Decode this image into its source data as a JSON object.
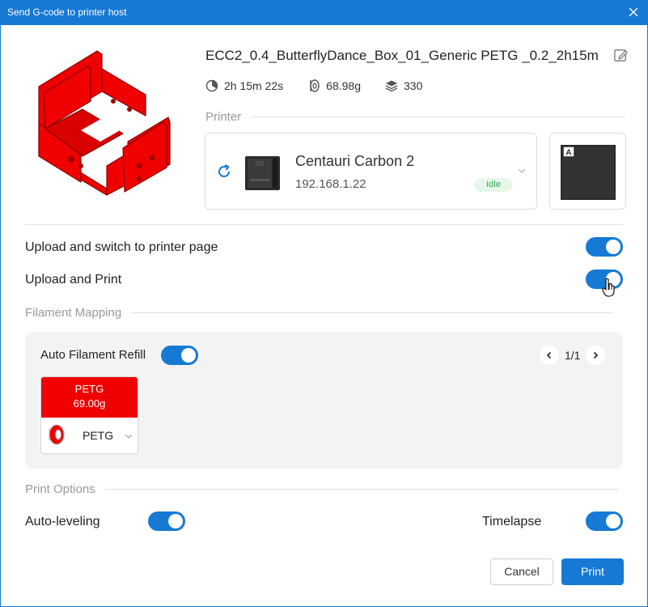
{
  "window": {
    "title": "Send G-code to printer host"
  },
  "file": {
    "name": "ECC2_0.4_ButterflyDance_Box_01_Generic PETG _0.2_2h15m",
    "print_time": "2h 15m 22s",
    "filament_weight": "68.98g",
    "layers": "330"
  },
  "printer": {
    "section_label": "Printer",
    "name": "Centauri Carbon 2",
    "ip": "192.168.1.22",
    "status": "Idle",
    "plate_letter": "A"
  },
  "options": {
    "upload_switch": {
      "label": "Upload and switch to printer page",
      "enabled": true
    },
    "upload_print": {
      "label": "Upload and Print",
      "enabled": true
    }
  },
  "filament_mapping": {
    "section_label": "Filament Mapping",
    "auto_refill": {
      "label": "Auto Filament Refill",
      "enabled": true
    },
    "page": "1/1",
    "slots": [
      {
        "type": "PETG",
        "weight": "69.00g",
        "color": "#f00000",
        "mapped": "PETG"
      }
    ]
  },
  "print_options": {
    "section_label": "Print Options",
    "auto_leveling": {
      "label": "Auto-leveling",
      "enabled": true
    },
    "timelapse": {
      "label": "Timelapse",
      "enabled": true
    }
  },
  "buttons": {
    "cancel": "Cancel",
    "print": "Print"
  },
  "colors": {
    "accent": "#1679d4",
    "model": "#f00000",
    "idle_bg": "#e7f7ea",
    "idle_text": "#2fa84f"
  },
  "icons": {
    "close": "close-icon",
    "edit": "edit-icon",
    "time": "clock-icon",
    "weight": "filament-icon",
    "layers": "layers-icon",
    "refresh": "refresh-icon",
    "dropdown": "chevron-down-icon",
    "prev": "chevron-left-icon",
    "next": "chevron-right-icon",
    "spool": "spool-icon"
  }
}
